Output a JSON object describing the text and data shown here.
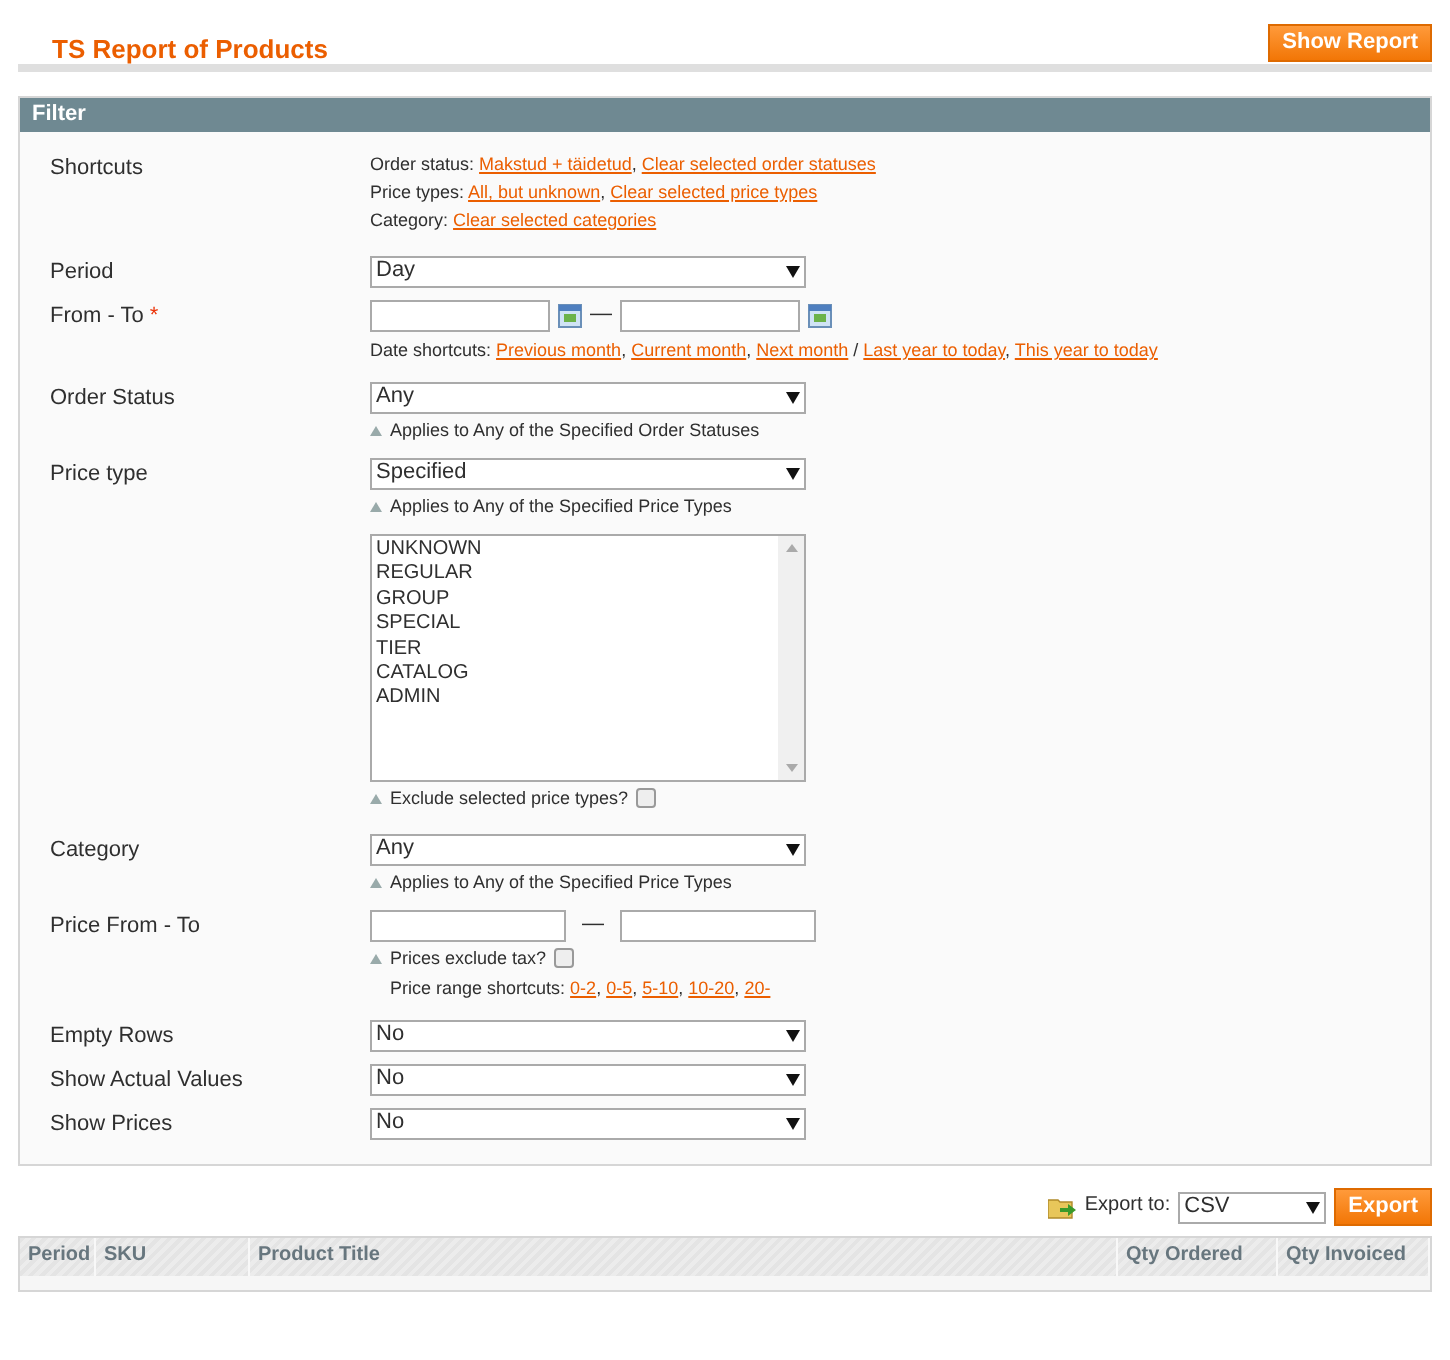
{
  "page_title": "TS Report of Products",
  "show_report_button": "Show Report",
  "filter": {
    "title": "Filter",
    "rows": [
      {
        "kind": "shortcuts",
        "label": "Shortcuts",
        "lines": [
          {
            "prefix": "Order status:",
            "links": [
              {
                "text": "Makstud + täidetud",
                "after": ","
              },
              {
                "text": "Clear selected order statuses"
              }
            ]
          },
          {
            "prefix": "Price types:",
            "links": [
              {
                "text": "All, but unknown",
                "after": ","
              },
              {
                "text": "Clear selected price types"
              }
            ]
          },
          {
            "prefix": "Category:",
            "links": [
              {
                "text": "Clear selected categories"
              }
            ]
          }
        ]
      },
      {
        "kind": "select",
        "label": "Period",
        "value": "Day"
      },
      {
        "kind": "date_range",
        "label": "From - To",
        "required_mark": "*",
        "separator": "—",
        "shortcuts": {
          "prefix": "Date shortcuts:",
          "links": [
            {
              "text": "Previous month",
              "after": ","
            },
            {
              "text": "Current month",
              "after": ","
            },
            {
              "text": "Next month",
              "after": "/"
            },
            {
              "text": "Last year to today",
              "after": ","
            },
            {
              "text": "This year to today"
            }
          ]
        }
      },
      {
        "kind": "select",
        "label": "Order Status",
        "value": "Any",
        "hint": "Applies to Any of the Specified Order Statuses"
      },
      {
        "kind": "select",
        "label": "Price type",
        "value": "Specified",
        "hint": "Applies to Any of the Specified Price Types"
      },
      {
        "kind": "multiselect",
        "options": [
          {
            "text": "UNKNOWN",
            "selected": false
          },
          {
            "text": "REGULAR",
            "selected": false
          },
          {
            "text": "GROUP",
            "selected": false
          },
          {
            "text": "SPECIAL",
            "selected": false
          },
          {
            "text": "TIER",
            "selected": false
          },
          {
            "text": "CATALOG",
            "selected": false
          },
          {
            "text": "ADMIN",
            "selected": false
          }
        ],
        "check_hint": "Exclude selected price types?",
        "checked": false
      },
      {
        "kind": "select",
        "label": "Category",
        "value": "Any",
        "hint": "Applies to Any of the Specified Price Types"
      },
      {
        "kind": "price_range",
        "label": "Price From - To",
        "separator": "—",
        "check_hint": "Prices exclude tax?",
        "checked": false,
        "shortcuts": {
          "prefix": "Price range shortcuts:",
          "links": [
            {
              "text": "0-2",
              "after": ","
            },
            {
              "text": "0-5",
              "after": ","
            },
            {
              "text": "5-10",
              "after": ","
            },
            {
              "text": "10-20",
              "after": ","
            },
            {
              "text": "20-"
            }
          ]
        }
      },
      {
        "kind": "select",
        "label": "Empty Rows",
        "value": "No"
      },
      {
        "kind": "select",
        "label": "Show Actual Values",
        "value": "No"
      },
      {
        "kind": "select",
        "label": "Show Prices",
        "value": "No"
      }
    ]
  },
  "export": {
    "label": "Export to:",
    "format": "CSV",
    "button": "Export"
  },
  "table": {
    "columns": [
      "Period",
      "SKU",
      "Product Title",
      "Qty Ordered",
      "Qty Invoiced"
    ]
  }
}
